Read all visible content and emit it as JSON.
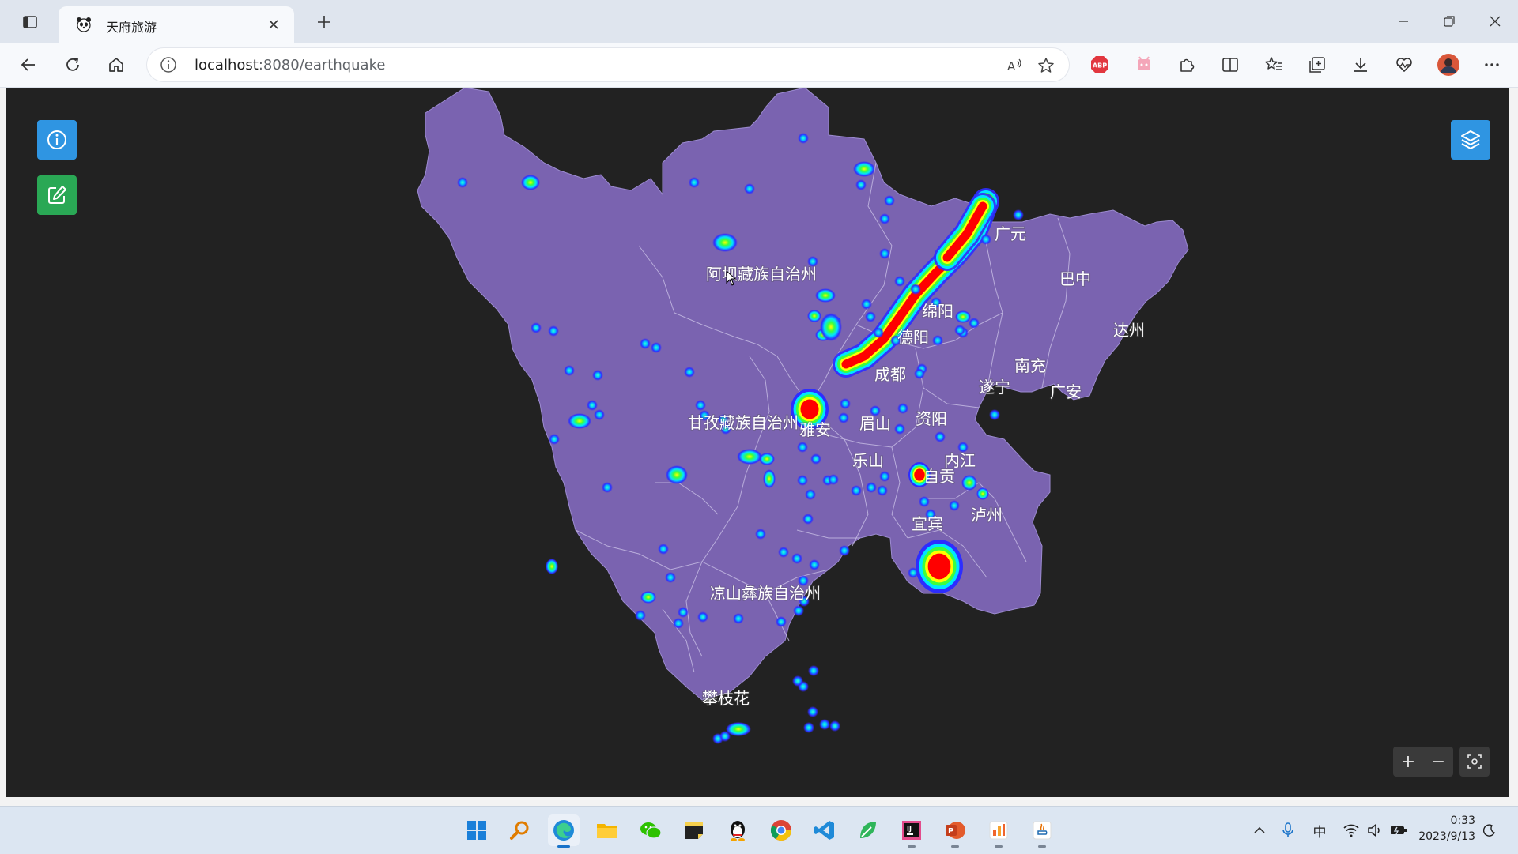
{
  "browser": {
    "tab": {
      "title": "天府旅游",
      "favicon": "panda-icon"
    },
    "address": {
      "host": "localhost",
      "rest": ":8080/earthquake"
    },
    "window_controls": [
      "minimize",
      "restore",
      "close"
    ]
  },
  "map": {
    "background_color": "#222222",
    "region_color": "#7a63b0",
    "labels": [
      "广元",
      "巴中",
      "阿坝藏族自治州",
      "绵阳",
      "达州",
      "德阳",
      "南充",
      "成都",
      "遂宁",
      "广安",
      "甘孜藏族自治州",
      "雅安",
      "眉山",
      "资阳",
      "乐山",
      "内江",
      "自贡",
      "宜宾",
      "泸州",
      "凉山彝族自治州",
      "攀枝花"
    ],
    "heat_colors": {
      "low": "#2d2dff",
      "mid": "#00e5ff",
      "mid2": "#3cff3c",
      "high": "#ffff00",
      "max": "#ff0000"
    },
    "controls": {
      "info_button": "info-icon",
      "edit_button": "edit-icon",
      "layers_button": "layers-icon",
      "zoom_in": "+",
      "zoom_out": "−",
      "fit": "fit-screen-icon"
    }
  },
  "taskbar": {
    "apps": [
      "windows-start",
      "search",
      "edge",
      "file-explorer",
      "wechat",
      "sticky-notes",
      "qq",
      "chrome",
      "vscode",
      "app-green",
      "intellij",
      "powerpoint",
      "app-orange",
      "java-app"
    ],
    "clock": {
      "time": "0:33",
      "date": "2023/9/13"
    },
    "ime": "中"
  }
}
